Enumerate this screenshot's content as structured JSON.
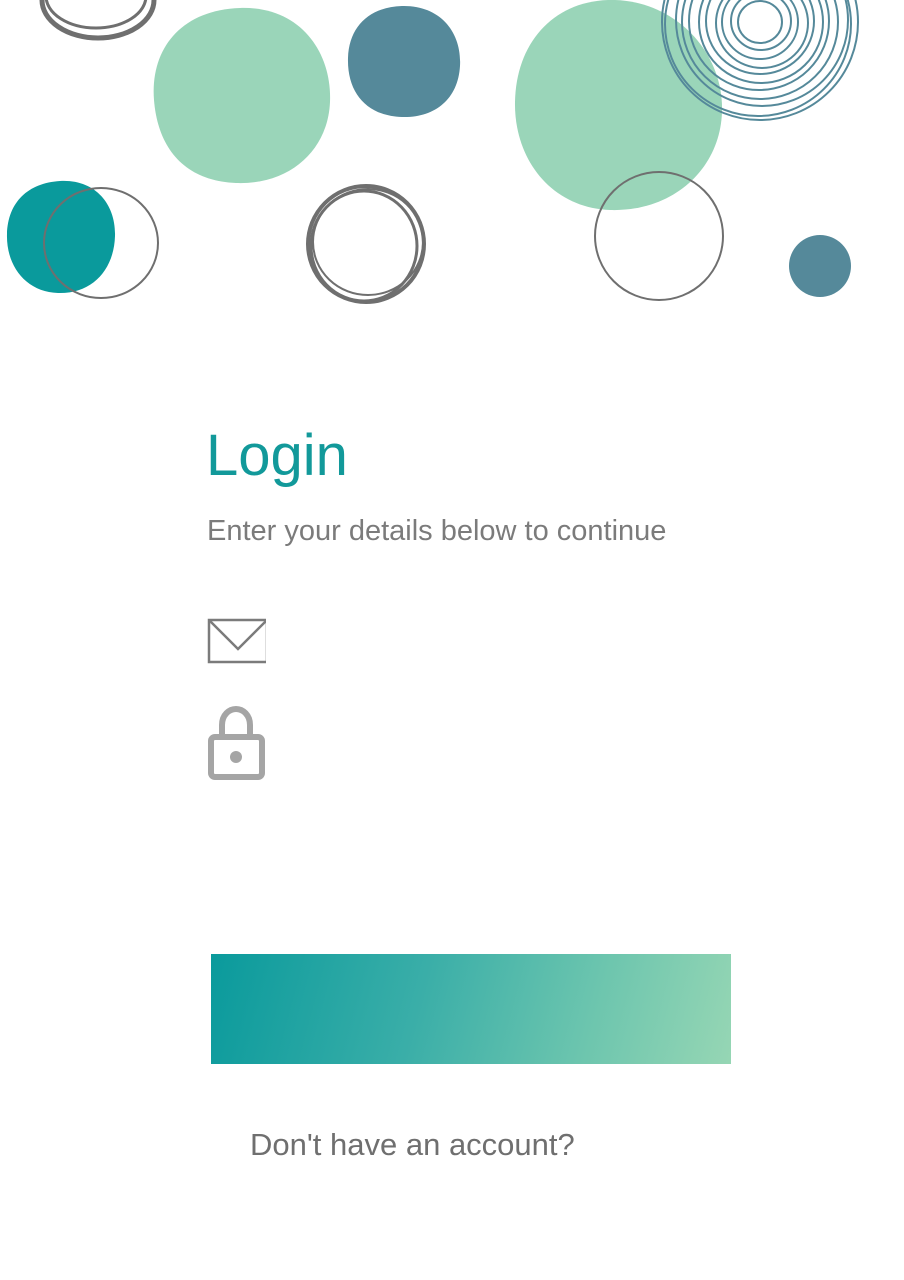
{
  "colors": {
    "accent": "#12999a",
    "mint": "#9ad5b9",
    "slate_blue": "#55899a",
    "teal": "#0a9a9c",
    "outline_gray": "#6f6f6f",
    "text_gray": "#7b7b7b",
    "icon_gray": "#a5a5a5"
  },
  "login": {
    "title": "Login",
    "subtitle": "Enter your details below to continue"
  },
  "email_field": {
    "icon": "envelope-icon",
    "value": "",
    "placeholder": ""
  },
  "password_field": {
    "icon": "lock-icon",
    "value": "",
    "placeholder": ""
  },
  "login_button": {
    "label": ""
  },
  "signup": {
    "prompt": "Don't have an account?",
    "link_label": ""
  }
}
